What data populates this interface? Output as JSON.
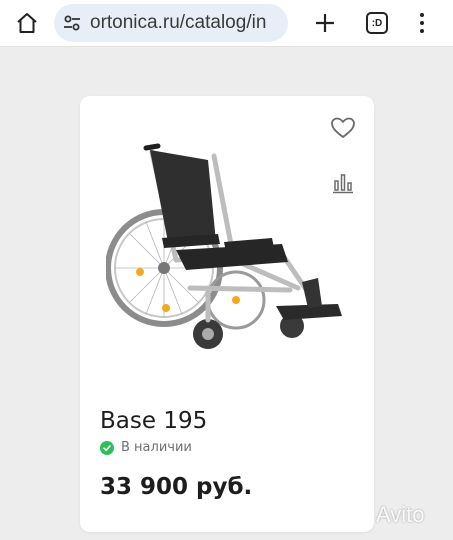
{
  "browser": {
    "url": "ortonica.ru/catalog/in",
    "tabs_label": ":D",
    "icons": [
      "home-icon",
      "site-settings-icon",
      "plus-icon",
      "tabs-icon",
      "more-vert-icon"
    ]
  },
  "product": {
    "name": "Base 195",
    "availability": "В наличии",
    "price": "33 900 руб.",
    "image": "wheelchair-photo",
    "icons": [
      "heart-icon",
      "compare-bars-icon",
      "check-circle-icon"
    ]
  },
  "watermark": {
    "text": "Avito"
  },
  "colors": {
    "page_bg": "#ededed",
    "url_pill": "#e8eef8",
    "in_stock_green": "#2fbf5a",
    "text_dark": "#1d1d1d",
    "text_muted": "#707070"
  }
}
